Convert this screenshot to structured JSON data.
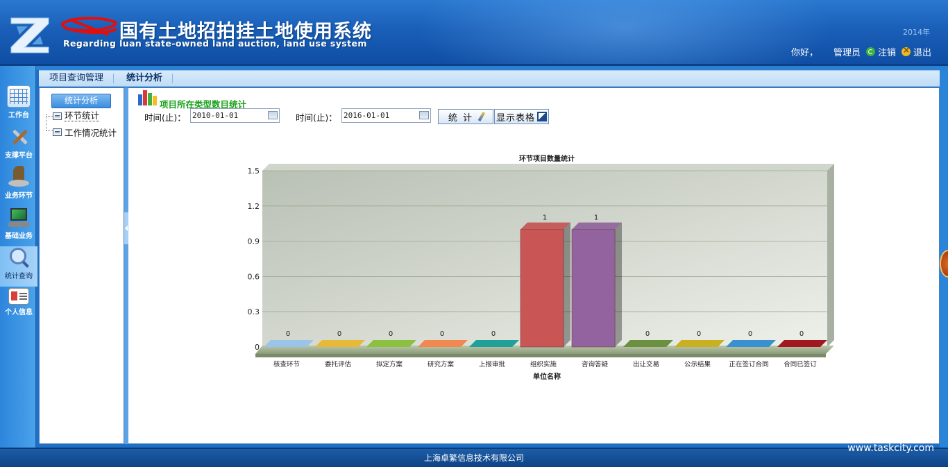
{
  "header": {
    "title_cn": "国有土地招拍挂土地使用系统",
    "title_en": "Regarding luan state-owned land auction, land use system",
    "year": "2014年",
    "greeting": "你好，",
    "user": "管理员",
    "logout_label": "注销",
    "exit_label": "退出"
  },
  "leftnav": {
    "items": [
      {
        "label": "工作台",
        "icon": "calendar-grid-icon"
      },
      {
        "label": "支撑平台",
        "icon": "tools-icon"
      },
      {
        "label": "业务环节",
        "icon": "chess-knight-icon"
      },
      {
        "label": "基础业务",
        "icon": "monitor-icon"
      },
      {
        "label": "统计查询",
        "icon": "magnifier-chart-icon"
      },
      {
        "label": "个人信息",
        "icon": "id-card-icon"
      }
    ]
  },
  "topmenu": {
    "items": [
      {
        "label": "项目查询管理"
      },
      {
        "label": "统计分析"
      }
    ]
  },
  "sidebar": {
    "button": "统计分析",
    "tree": [
      {
        "label": "环节统计"
      },
      {
        "label": "工作情况统计"
      }
    ]
  },
  "main": {
    "section_title": "项目所在类型数目统计",
    "from_label": "时间(止)：",
    "from_value": "2010-01-01",
    "to_label": "时间(止)：",
    "to_value": "2016-01-01",
    "stat_button": "统 计",
    "table_button": "显示表格"
  },
  "chart_data": {
    "type": "bar",
    "title": "环节项目数量统计",
    "xlabel": "单位名称",
    "ylabel": "",
    "ylim": [
      0,
      1.5
    ],
    "yticks": [
      "0",
      "0.3",
      "0.6",
      "0.9",
      "1.2",
      "1.5"
    ],
    "categories": [
      "核查环节",
      "委托评估",
      "拟定方案",
      "研究方案",
      "上报审批",
      "组织实施",
      "咨询答疑",
      "出让交易",
      "公示结果",
      "正在签订合同",
      "合同已签订"
    ],
    "values": [
      0,
      0,
      0,
      0,
      0,
      1,
      1,
      0,
      0,
      0,
      0
    ],
    "colors": [
      "#9cc3e8",
      "#e8b838",
      "#8cc040",
      "#f08850",
      "#20a098",
      "#c03838",
      "#804890",
      "#6a9040",
      "#c8b020",
      "#3890d0",
      "#a01820"
    ]
  },
  "footer": {
    "company": "上海卓繁信息技术有限公司",
    "watermark": "www.taskcity.com"
  }
}
